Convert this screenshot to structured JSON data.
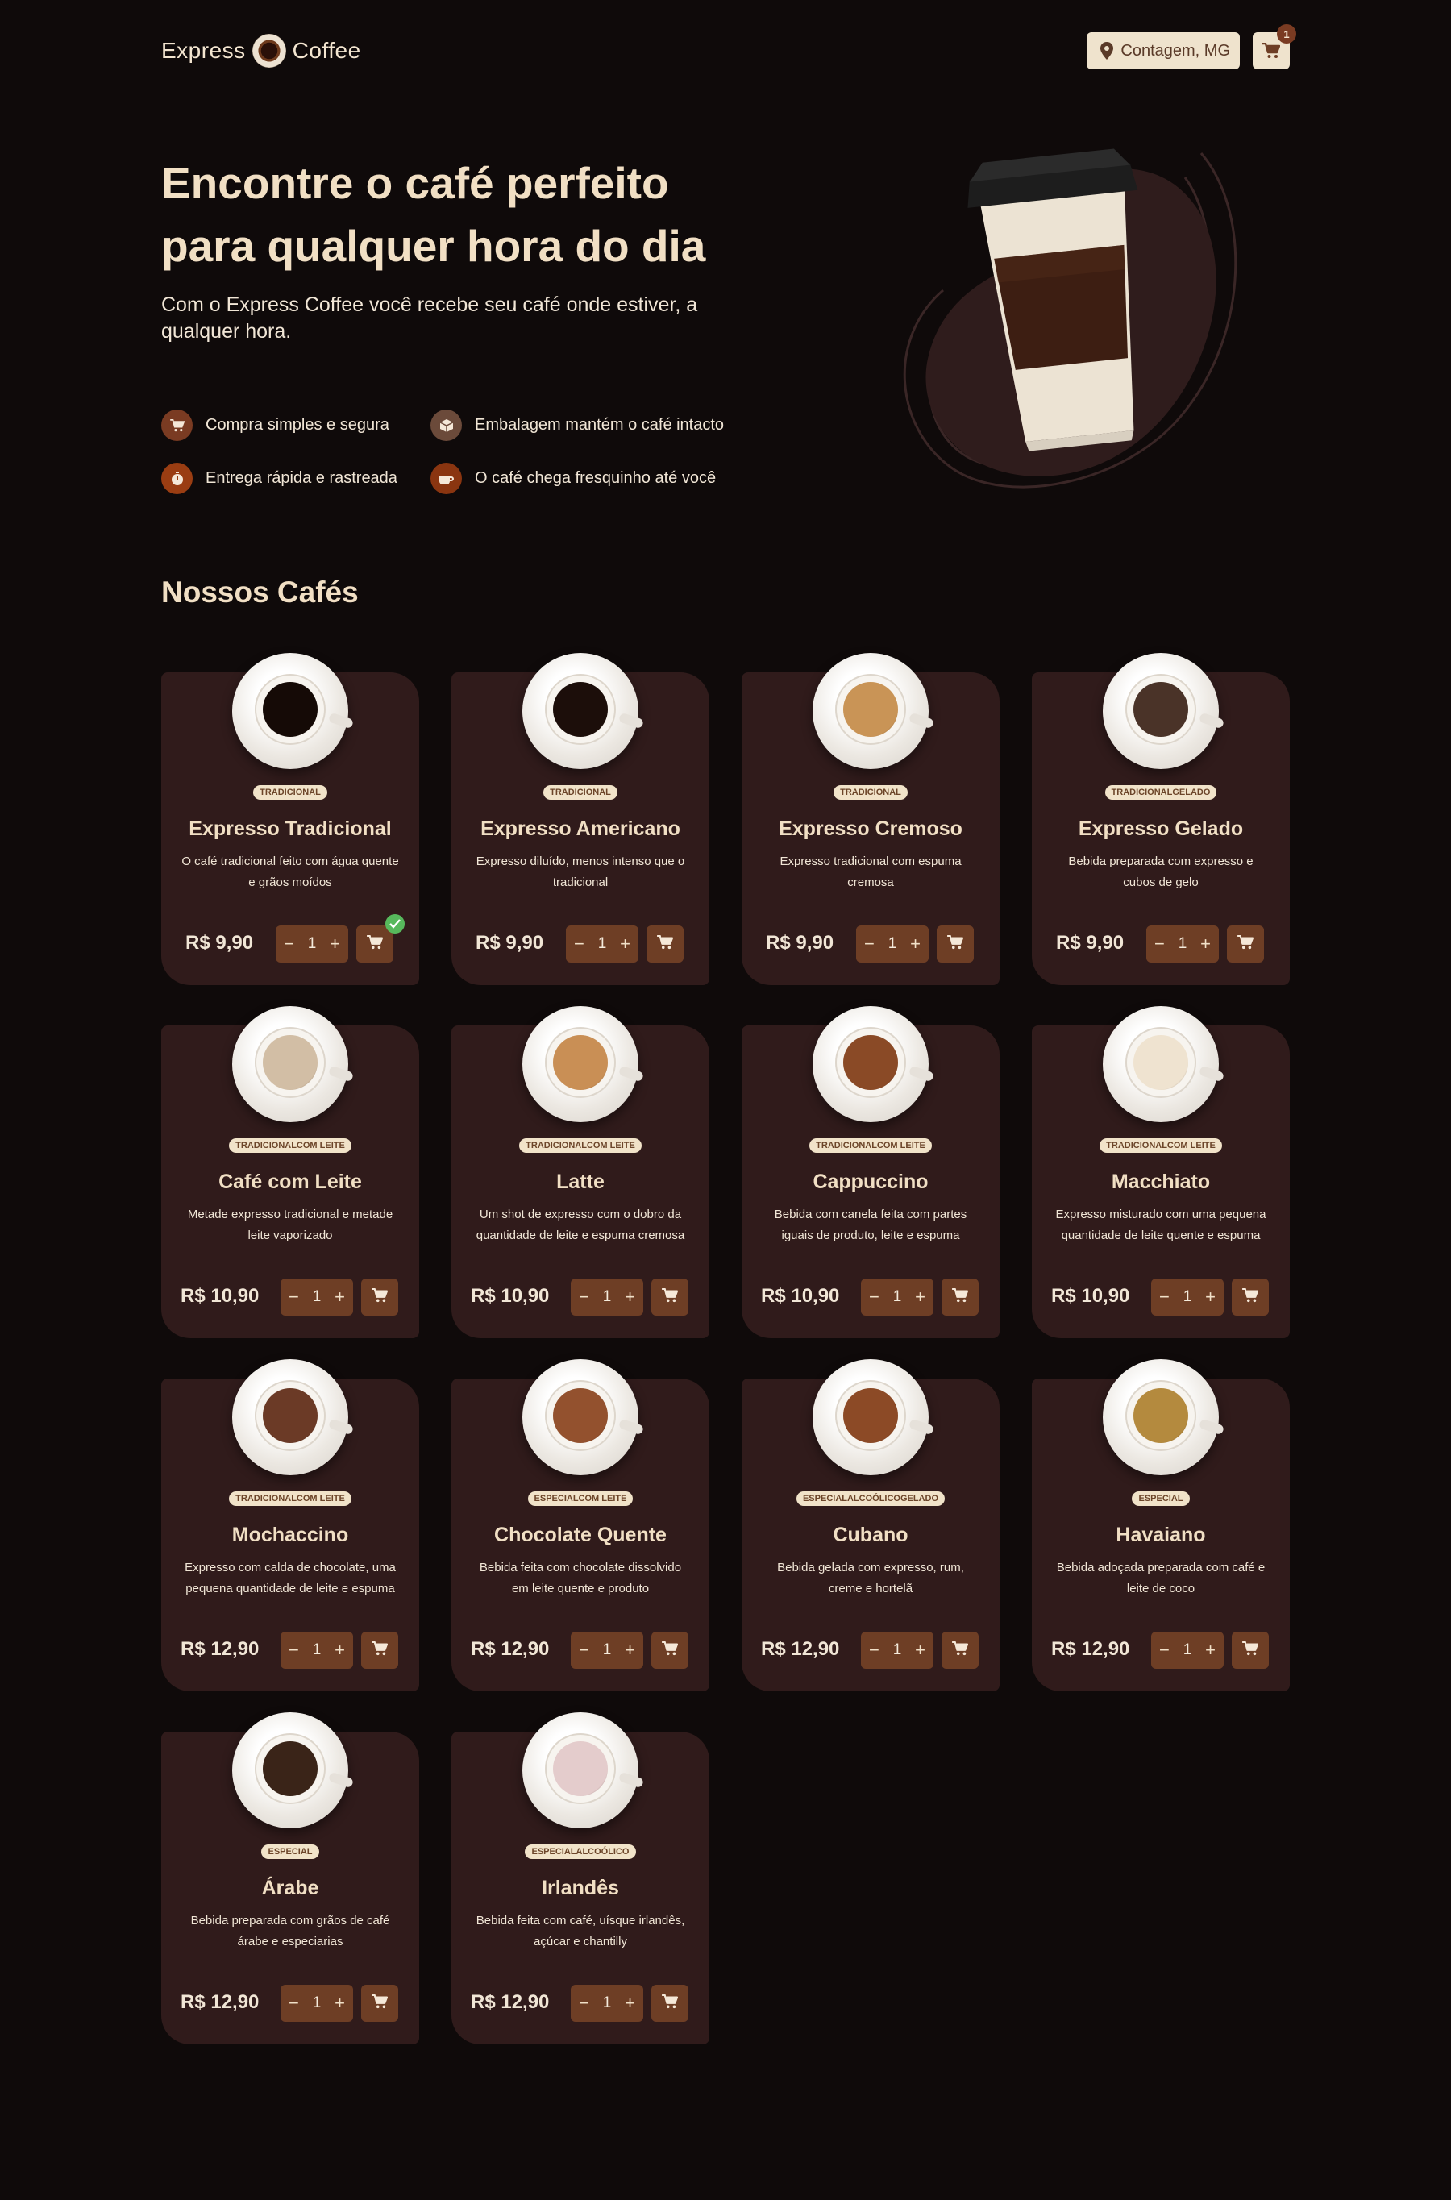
{
  "brand": {
    "left": "Express",
    "right": "Coffee"
  },
  "header": {
    "location": "Contagem, MG",
    "cart_count": "1"
  },
  "hero": {
    "title": "Encontre o café perfeito para qualquer hora do dia",
    "subtitle": "Com o Express Coffee você recebe seu café onde estiver, a qualquer hora.",
    "benefits": [
      {
        "label": "Compra simples e segura",
        "icon": "cart-icon",
        "color": "#7a3b22"
      },
      {
        "label": "Embalagem mantém o café intacto",
        "icon": "box-icon",
        "color": "#6b4a3a"
      },
      {
        "label": "Entrega rápida e rastreada",
        "icon": "timer-icon",
        "color": "#9a3d12"
      },
      {
        "label": "O café chega fresquinho até você",
        "icon": "coffee-icon",
        "color": "#8a3510"
      }
    ]
  },
  "section_title": "Nossos Cafés",
  "products": [
    {
      "tag": "TRADICIONAL",
      "name": "Expresso Tradicional",
      "description": "O café tradicional feito com água quente e grãos moídos",
      "price": "R$ 9,90",
      "qty": "1",
      "in_cart": true,
      "coffee": "#150a06"
    },
    {
      "tag": "TRADICIONAL",
      "name": "Expresso Americano",
      "description": "Expresso diluído, menos intenso que o tradicional",
      "price": "R$ 9,90",
      "qty": "1",
      "in_cart": false,
      "coffee": "#1c0e0a"
    },
    {
      "tag": "TRADICIONAL",
      "name": "Expresso Cremoso",
      "description": "Expresso tradicional com espuma cremosa",
      "price": "R$ 9,90",
      "qty": "1",
      "in_cart": false,
      "coffee": "#c99456"
    },
    {
      "tag": "TRADICIONALGELADO",
      "name": "Expresso Gelado",
      "description": "Bebida preparada com expresso e cubos de gelo",
      "price": "R$ 9,90",
      "qty": "1",
      "in_cart": false,
      "coffee": "#4a3328"
    },
    {
      "tag": "TRADICIONALCOM LEITE",
      "name": "Café com Leite",
      "description": "Metade expresso tradicional e metade leite vaporizado",
      "price": "R$ 10,90",
      "qty": "1",
      "in_cart": false,
      "coffee": "#d2bea5"
    },
    {
      "tag": "TRADICIONALCOM LEITE",
      "name": "Latte",
      "description": "Um shot de expresso com o dobro da quantidade de leite e espuma cremosa",
      "price": "R$ 10,90",
      "qty": "1",
      "in_cart": false,
      "coffee": "#c98f55"
    },
    {
      "tag": "TRADICIONALCOM LEITE",
      "name": "Cappuccino",
      "description": "Bebida com canela feita com partes iguais de produto, leite e espuma",
      "price": "R$ 10,90",
      "qty": "1",
      "in_cart": false,
      "coffee": "#8a4a26"
    },
    {
      "tag": "TRADICIONALCOM LEITE",
      "name": "Macchiato",
      "description": "Expresso misturado com uma pequena quantidade de leite quente e espuma",
      "price": "R$ 10,90",
      "qty": "1",
      "in_cart": false,
      "coffee": "#efe3d0"
    },
    {
      "tag": "TRADICIONALCOM LEITE",
      "name": "Mochaccino",
      "description": "Expresso com calda de chocolate, uma pequena quantidade de leite e espuma",
      "price": "R$ 12,90",
      "qty": "1",
      "in_cart": false,
      "coffee": "#6b3a26"
    },
    {
      "tag": "ESPECIALCOM LEITE",
      "name": "Chocolate Quente",
      "description": "Bebida feita com chocolate dissolvido em leite quente e produto",
      "price": "R$ 12,90",
      "qty": "1",
      "in_cart": false,
      "coffee": "#93512e"
    },
    {
      "tag": "ESPECIALALCOÓLICOGELADO",
      "name": "Cubano",
      "description": "Bebida gelada com expresso, rum, creme e hortelã",
      "price": "R$ 12,90",
      "qty": "1",
      "in_cart": false,
      "coffee": "#8c4a26"
    },
    {
      "tag": "ESPECIAL",
      "name": "Havaiano",
      "description": "Bebida adoçada preparada com café e leite de coco",
      "price": "R$ 12,90",
      "qty": "1",
      "in_cart": false,
      "coffee": "#b48a3e"
    },
    {
      "tag": "ESPECIAL",
      "name": "Árabe",
      "description": "Bebida preparada com grãos de café árabe e especiarias",
      "price": "R$ 12,90",
      "qty": "1",
      "in_cart": false,
      "coffee": "#3a2418"
    },
    {
      "tag": "ESPECIALALCOÓLICO",
      "name": "Irlandês",
      "description": "Bebida feita com café, uísque irlandês, açúcar e chantilly",
      "price": "R$ 12,90",
      "qty": "1",
      "in_cart": false,
      "coffee": "#e4cccc"
    }
  ]
}
